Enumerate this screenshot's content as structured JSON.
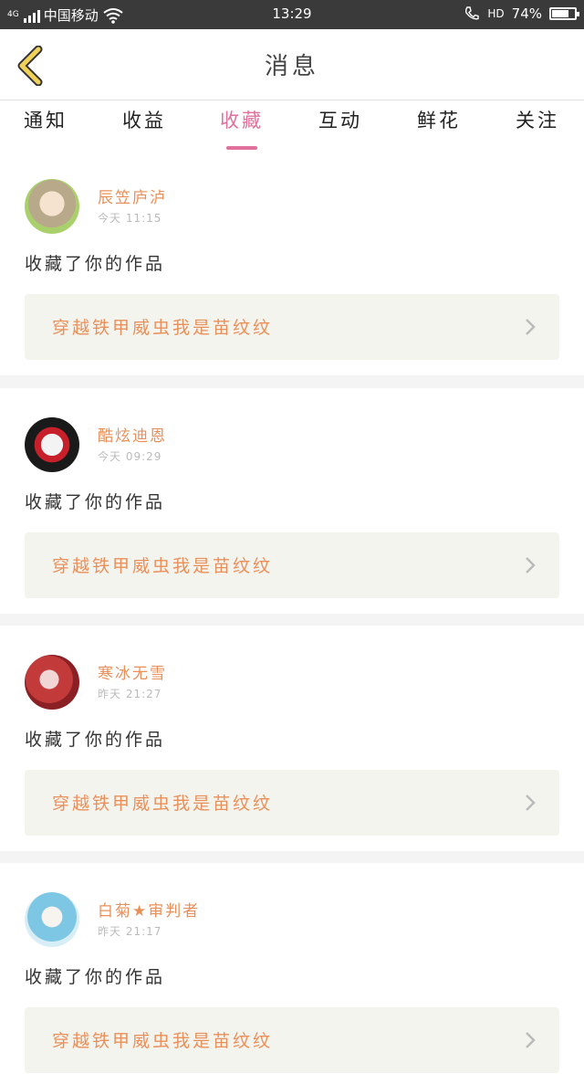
{
  "status_bar": {
    "network": "4G",
    "carrier": "中国移动",
    "time": "13:29",
    "hd": "HD",
    "battery_text": "74%",
    "battery_level": 0.74
  },
  "header": {
    "title": "消息"
  },
  "tabs": [
    {
      "label": "通知",
      "active": false
    },
    {
      "label": "收益",
      "active": false
    },
    {
      "label": "收藏",
      "active": true
    },
    {
      "label": "互动",
      "active": false
    },
    {
      "label": "鲜花",
      "active": false
    },
    {
      "label": "关注",
      "active": false
    }
  ],
  "messages": [
    {
      "user": "辰笠庐泸",
      "time": "今天 11:15",
      "action": "收藏了你的作品",
      "work": "穿越铁甲威虫我是苗纹纹"
    },
    {
      "user": "酷炫迪恩",
      "time": "今天 09:29",
      "action": "收藏了你的作品",
      "work": "穿越铁甲威虫我是苗纹纹"
    },
    {
      "user": "寒冰无雪",
      "time": "昨天 21:27",
      "action": "收藏了你的作品",
      "work": "穿越铁甲威虫我是苗纹纹"
    },
    {
      "user": "白菊★审判者",
      "time": "昨天 21:17",
      "action": "收藏了你的作品",
      "work": "穿越铁甲威虫我是苗纹纹"
    }
  ],
  "colors": {
    "accent_pink": "#e0709c",
    "name_orange": "#e9905a",
    "back_arrow_yellow": "#f0d25a"
  }
}
